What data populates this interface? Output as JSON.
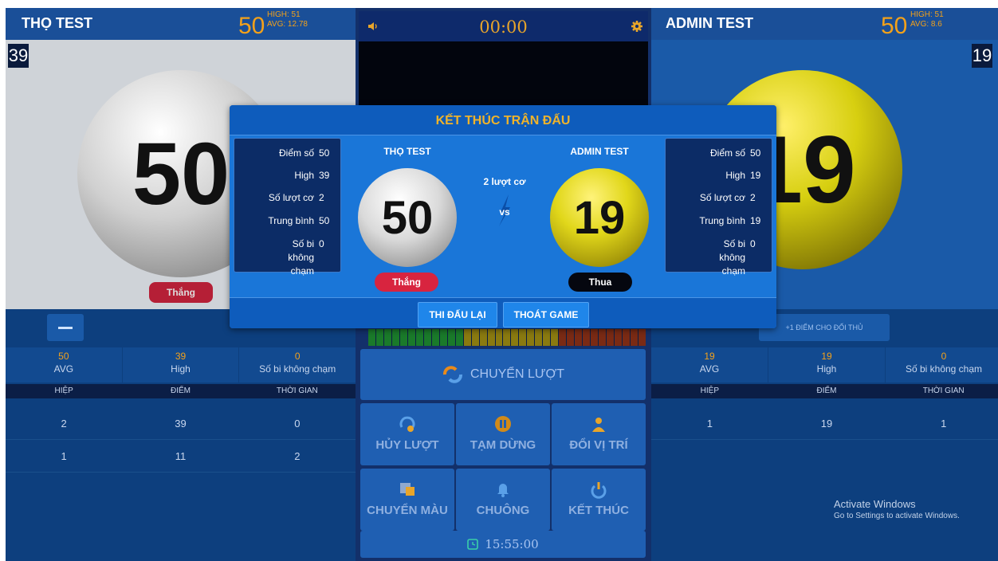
{
  "left": {
    "name": "THỌ TEST",
    "score": "50",
    "high_label": "HIGH: 51",
    "avg_label": "AVG: 12.78",
    "inning": "39",
    "ball_number": "50",
    "badge": "Thắng",
    "stats": [
      {
        "value": "50",
        "label": "AVG"
      },
      {
        "value": "39",
        "label": "High"
      },
      {
        "value": "0",
        "label": "Số bi không chạm"
      }
    ],
    "table_headers": [
      "HIỆP",
      "ĐIỂM",
      "THỜI GIAN"
    ],
    "rows": [
      [
        "2",
        "39",
        "0"
      ],
      [
        "1",
        "11",
        "2"
      ]
    ]
  },
  "right": {
    "name": "ADMIN TEST",
    "score": "50",
    "high_label": "HIGH: 51",
    "avg_label": "AVG: 8.6",
    "inning": "19",
    "ball_number": "19",
    "plus_button": "+1 ĐIỂM CHO ĐỐI THỦ",
    "stats": [
      {
        "value": "19",
        "label": "AVG"
      },
      {
        "value": "19",
        "label": "High"
      },
      {
        "value": "0",
        "label": "Số bi không chạm"
      }
    ],
    "table_headers": [
      "HIỆP",
      "ĐIỂM",
      "THỜI GIAN"
    ],
    "rows": [
      [
        "1",
        "19",
        "1"
      ]
    ]
  },
  "center": {
    "timer": "00:00",
    "switch_turn": "CHUYỂN LƯỢT",
    "buttons": [
      "HỦY LƯỢT",
      "TẠM DỪNG",
      "ĐỔI VỊ TRÍ",
      "CHUYỂN MÀU",
      "CHUÔNG",
      "KẾT THÚC"
    ],
    "clock": "15:55:00"
  },
  "modal": {
    "title": "KẾT THÚC TRẬN ĐẤU",
    "turns_text": "2 lượt cơ",
    "vs_text": "vs",
    "left": {
      "name": "THỌ TEST",
      "ball": "50",
      "result": "Thắng",
      "stats": [
        {
          "label": "Điểm số",
          "value": "50"
        },
        {
          "label": "High",
          "value": "39"
        },
        {
          "label": "Số lượt cơ",
          "value": "2"
        },
        {
          "label": "Trung bình",
          "value": "50"
        },
        {
          "label": "Số bi không chạm",
          "value": "0"
        }
      ]
    },
    "right": {
      "name": "ADMIN TEST",
      "ball": "19",
      "result": "Thua",
      "stats": [
        {
          "label": "Điểm số",
          "value": "50"
        },
        {
          "label": "High",
          "value": "19"
        },
        {
          "label": "Số lượt cơ",
          "value": "2"
        },
        {
          "label": "Trung bình",
          "value": "19"
        },
        {
          "label": "Số bi không chạm",
          "value": "0"
        }
      ]
    },
    "replay_button": "THI ĐẤU LẠI",
    "exit_button": "THOÁT GAME"
  },
  "watermark": {
    "line1": "Activate Windows",
    "line2": "Go to Settings to activate Windows."
  },
  "colors": {
    "panel_bg": "#0d3f7e",
    "accent_orange": "#f3a11a",
    "modal_bg": "#1a76d8",
    "win_red": "#d8243f",
    "lose_black": "#05070f",
    "ball_yellow": "#e1d71a"
  },
  "icons": [
    "speaker-icon",
    "gear-icon",
    "switch-turn-icon",
    "undo-icon",
    "pause-icon",
    "swap-position-icon",
    "switch-color-icon",
    "bell-icon",
    "power-icon",
    "clock-icon"
  ]
}
